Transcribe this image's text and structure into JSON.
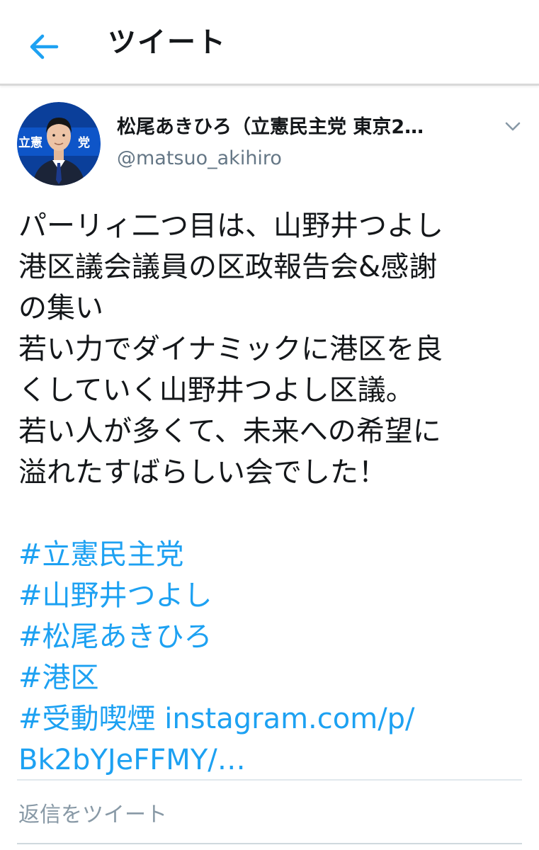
{
  "header": {
    "title": "ツイート"
  },
  "colors": {
    "accent": "#1da1f2",
    "text": "#14171a",
    "secondary": "#657786"
  },
  "tweet": {
    "display_name": "松尾あきひろ（立憲民主党 東京2…",
    "handle": "@matsuo_akihiro",
    "lines": [
      "パーリィ二つ目は、山野井つよし",
      "港区議会議員の区政報告会&感謝",
      "の集い",
      "若い力でダイナミックに港区を良",
      "くしていく山野井つよし区議。",
      "若い人が多くて、未来への希望に",
      "溢れたすばらしい会でした！"
    ],
    "hashtags": [
      "#立憲民主党",
      "#山野井つよし",
      "#松尾あきひろ",
      "#港区"
    ],
    "last_hashtag": "#受動喫煙",
    "link_part1": "instagram.com/p/",
    "link_part2": "Bk2bYJeFFMY/…"
  },
  "reply": {
    "placeholder": "返信をツイート"
  },
  "icons": {
    "back": "arrow-left-icon",
    "caret": "chevron-down-icon"
  },
  "avatar": {
    "badge_text": "立憲 主党"
  }
}
